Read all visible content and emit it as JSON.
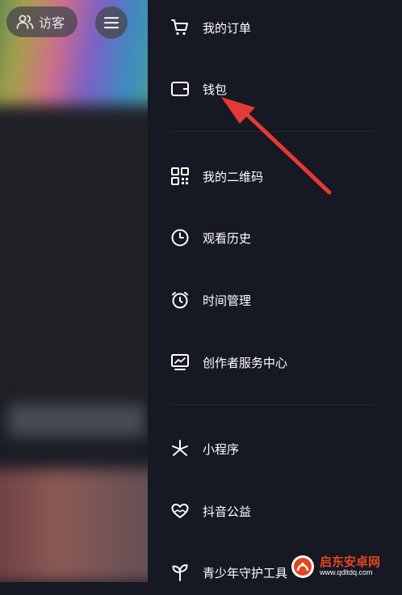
{
  "header": {
    "visitor_label": "访客",
    "visitor_icon": "people-icon",
    "menu_icon": "hamburger-icon"
  },
  "drawer": {
    "items": [
      {
        "label": "我的订单",
        "icon": "cart-icon"
      },
      {
        "label": "钱包",
        "icon": "wallet-icon"
      },
      {
        "label": "我的二维码",
        "icon": "qrcode-icon"
      },
      {
        "label": "观看历史",
        "icon": "clock-icon"
      },
      {
        "label": "时间管理",
        "icon": "alarm-clock-icon"
      },
      {
        "label": "创作者服务中心",
        "icon": "chart-monitor-icon"
      },
      {
        "label": "小程序",
        "icon": "sparkle-icon"
      },
      {
        "label": "抖音公益",
        "icon": "heart-hand-icon"
      },
      {
        "label": "青少年守护工具",
        "icon": "sprout-icon"
      }
    ]
  },
  "annotation": {
    "color": "#e53935",
    "target": "钱包"
  },
  "watermark": {
    "name_cn": "启东安卓网",
    "url": "www.qdltdq.com"
  },
  "colors": {
    "background": "#161823",
    "text": "#ffffff",
    "divider": "#262832"
  }
}
